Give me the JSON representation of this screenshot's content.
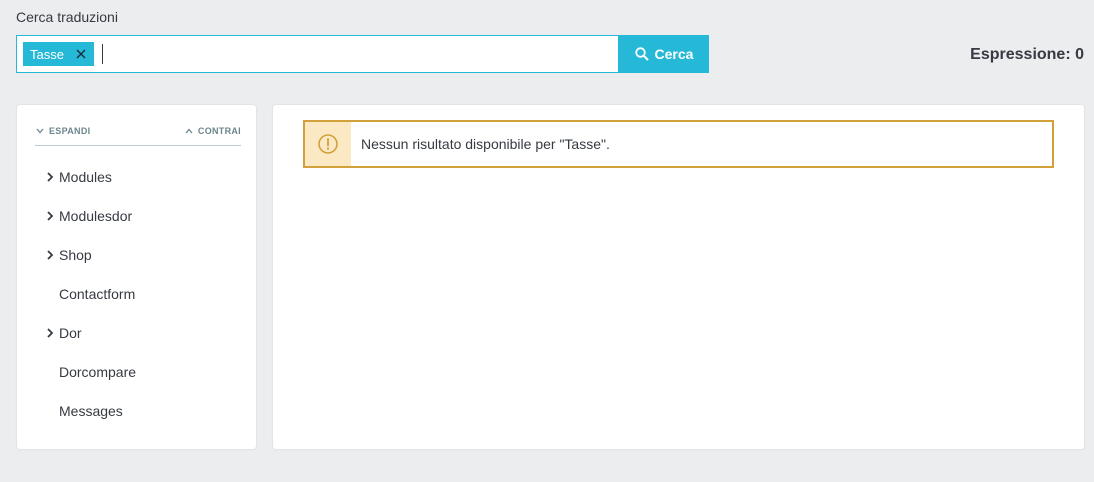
{
  "search": {
    "label": "Cerca traduzioni",
    "tag": "Tasse",
    "input_value": "",
    "button_label": "Cerca"
  },
  "expression_count": "Espressione: 0",
  "tree": {
    "expand_label": "ESPANDI",
    "collapse_label": "CONTRAI",
    "items": [
      {
        "label": "Modules",
        "has_children": true
      },
      {
        "label": "Modulesdor",
        "has_children": true
      },
      {
        "label": "Shop",
        "has_children": true
      },
      {
        "label": "Contactform",
        "has_children": false
      },
      {
        "label": "Dor",
        "has_children": true
      },
      {
        "label": "Dorcompare",
        "has_children": false
      },
      {
        "label": "Messages",
        "has_children": false
      }
    ]
  },
  "alert": {
    "message": "Nessun risultato disponibile per \"Tasse\".",
    "icon": "warning-icon"
  },
  "colors": {
    "accent": "#25b9d7",
    "warning_border": "#d3a13b",
    "warning_bg": "#fbe9c4",
    "page_bg": "#ebedef"
  }
}
